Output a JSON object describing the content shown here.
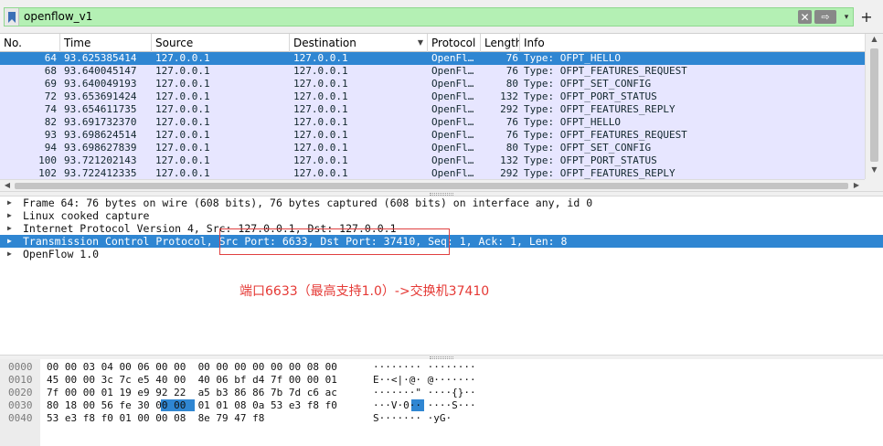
{
  "filter": {
    "value": "openflow_v1",
    "clear_glyph": "✕",
    "apply_glyph": "⇨",
    "dropdown_glyph": "▾",
    "add_glyph": "+",
    "color": "#b4f0b4"
  },
  "packet_list": {
    "columns": [
      {
        "label": "No."
      },
      {
        "label": "Time"
      },
      {
        "label": "Source"
      },
      {
        "label": "Destination"
      },
      {
        "label": "Protocol"
      },
      {
        "label": "Length"
      },
      {
        "label": "Info"
      }
    ],
    "rows": [
      {
        "no": "64",
        "time": "93.625385414",
        "src": "127.0.0.1",
        "dst": "127.0.0.1",
        "proto": "OpenFl…",
        "len": "76",
        "info": "Type: OFPT_HELLO",
        "selected": true
      },
      {
        "no": "68",
        "time": "93.640045147",
        "src": "127.0.0.1",
        "dst": "127.0.0.1",
        "proto": "OpenFl…",
        "len": "76",
        "info": "Type: OFPT_FEATURES_REQUEST",
        "selected": false
      },
      {
        "no": "69",
        "time": "93.640049193",
        "src": "127.0.0.1",
        "dst": "127.0.0.1",
        "proto": "OpenFl…",
        "len": "80",
        "info": "Type: OFPT_SET_CONFIG",
        "selected": false
      },
      {
        "no": "72",
        "time": "93.653691424",
        "src": "127.0.0.1",
        "dst": "127.0.0.1",
        "proto": "OpenFl…",
        "len": "132",
        "info": "Type: OFPT_PORT_STATUS",
        "selected": false
      },
      {
        "no": "74",
        "time": "93.654611735",
        "src": "127.0.0.1",
        "dst": "127.0.0.1",
        "proto": "OpenFl…",
        "len": "292",
        "info": "Type: OFPT_FEATURES_REPLY",
        "selected": false
      },
      {
        "no": "82",
        "time": "93.691732370",
        "src": "127.0.0.1",
        "dst": "127.0.0.1",
        "proto": "OpenFl…",
        "len": "76",
        "info": "Type: OFPT_HELLO",
        "selected": false
      },
      {
        "no": "93",
        "time": "93.698624514",
        "src": "127.0.0.1",
        "dst": "127.0.0.1",
        "proto": "OpenFl…",
        "len": "76",
        "info": "Type: OFPT_FEATURES_REQUEST",
        "selected": false
      },
      {
        "no": "94",
        "time": "93.698627839",
        "src": "127.0.0.1",
        "dst": "127.0.0.1",
        "proto": "OpenFl…",
        "len": "80",
        "info": "Type: OFPT_SET_CONFIG",
        "selected": false
      },
      {
        "no": "100",
        "time": "93.721202143",
        "src": "127.0.0.1",
        "dst": "127.0.0.1",
        "proto": "OpenFl…",
        "len": "132",
        "info": "Type: OFPT_PORT_STATUS",
        "selected": false
      },
      {
        "no": "102",
        "time": "93.722412335",
        "src": "127.0.0.1",
        "dst": "127.0.0.1",
        "proto": "OpenFl…",
        "len": "292",
        "info": "Type: OFPT_FEATURES_REPLY",
        "selected": false
      }
    ],
    "row_color": "#e7e6ff",
    "selected_color": "#2f86d2"
  },
  "details": {
    "rows": [
      {
        "text": "Frame 64: 76 bytes on wire (608 bits), 76 bytes captured (608 bits) on interface any, id 0",
        "selected": false
      },
      {
        "text": "Linux cooked capture",
        "selected": false
      },
      {
        "text": "Internet Protocol Version 4, Src: 127.0.0.1, Dst: 127.0.0.1",
        "selected": false
      },
      {
        "text": "Transmission Control Protocol, Src Port: 6633, Dst Port: 37410, Seq: 1, Ack: 1, Len: 8",
        "selected": true
      },
      {
        "text": "OpenFlow 1.0",
        "selected": false
      }
    ],
    "annotation": "端口6633（最高支持1.0）->交换机37410",
    "annotation_color": "#e53935"
  },
  "bytes": {
    "rows": [
      {
        "offset": "0000",
        "hex": "00 00 03 04 00 06 00 00  00 00 00 00 00 00 08 00",
        "ascii": "········ ········"
      },
      {
        "offset": "0010",
        "hex": "45 00 00 3c 7c e5 40 00  40 06 bf d4 7f 00 00 01",
        "ascii": "E··<|·@· @·······"
      },
      {
        "offset": "0020",
        "hex": "7f 00 00 01 19 e9 92 22  a5 b3 86 86 7b 7d c6 ac",
        "ascii": "·······\" ····{}··"
      },
      {
        "offset": "0030",
        "hex": "80 18 00 56 fe 30 00 00  01 01 08 0a 53 e3 f8 f0",
        "ascii": "···V·0·· ····S···"
      },
      {
        "offset": "0040",
        "hex": "53 e3 f8 f0 01 00 00 08  8e 79 47 f8",
        "ascii": "S······· ·yG·"
      }
    ]
  }
}
